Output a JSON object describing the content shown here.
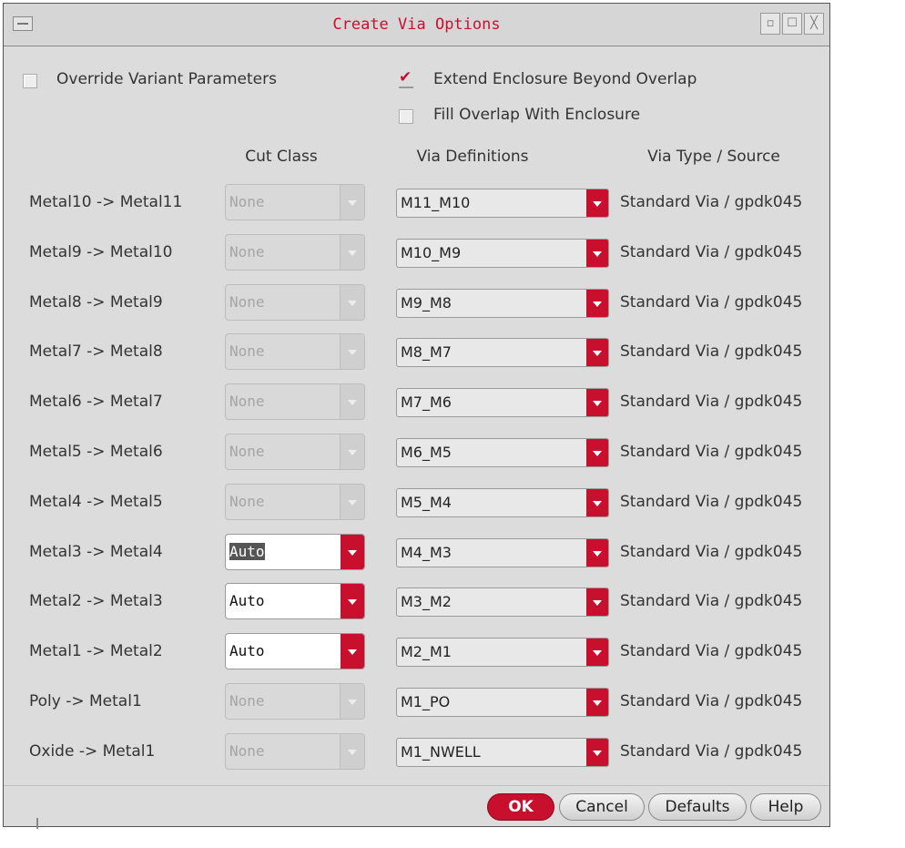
{
  "window": {
    "title": "Create Via Options"
  },
  "options": {
    "override_variant": {
      "label": "Override Variant Parameters",
      "checked": false
    },
    "extend_enclosure": {
      "label": "Extend Enclosure Beyond Overlap",
      "checked": true
    },
    "fill_overlap": {
      "label": "Fill Overlap With Enclosure",
      "checked": false
    }
  },
  "headers": {
    "cut_class": "Cut Class",
    "via_definitions": "Via Definitions",
    "via_type_source": "Via Type / Source"
  },
  "rows": [
    {
      "layers": "Metal10 -> Metal11",
      "cut_class": "None",
      "cut_enabled": false,
      "via": "M11_M10",
      "source": "Standard Via / gpdk045"
    },
    {
      "layers": "Metal9 -> Metal10",
      "cut_class": "None",
      "cut_enabled": false,
      "via": "M10_M9",
      "source": "Standard Via / gpdk045"
    },
    {
      "layers": "Metal8 -> Metal9",
      "cut_class": "None",
      "cut_enabled": false,
      "via": "M9_M8",
      "source": "Standard Via / gpdk045"
    },
    {
      "layers": "Metal7 -> Metal8",
      "cut_class": "None",
      "cut_enabled": false,
      "via": "M8_M7",
      "source": "Standard Via / gpdk045"
    },
    {
      "layers": "Metal6 -> Metal7",
      "cut_class": "None",
      "cut_enabled": false,
      "via": "M7_M6",
      "source": "Standard Via / gpdk045"
    },
    {
      "layers": "Metal5 -> Metal6",
      "cut_class": "None",
      "cut_enabled": false,
      "via": "M6_M5",
      "source": "Standard Via / gpdk045"
    },
    {
      "layers": "Metal4 -> Metal5",
      "cut_class": "None",
      "cut_enabled": false,
      "via": "M5_M4",
      "source": "Standard Via / gpdk045"
    },
    {
      "layers": "Metal3 -> Metal4",
      "cut_class": "Auto",
      "cut_enabled": true,
      "cut_selected": true,
      "via": "M4_M3",
      "source": "Standard Via / gpdk045"
    },
    {
      "layers": "Metal2 -> Metal3",
      "cut_class": "Auto",
      "cut_enabled": true,
      "via": "M3_M2",
      "source": "Standard Via / gpdk045"
    },
    {
      "layers": "Metal1 -> Metal2",
      "cut_class": "Auto",
      "cut_enabled": true,
      "via": "M2_M1",
      "source": "Standard Via / gpdk045"
    },
    {
      "layers": "Poly -> Metal1",
      "cut_class": "None",
      "cut_enabled": false,
      "via": "M1_PO",
      "source": "Standard Via / gpdk045"
    },
    {
      "layers": "Oxide -> Metal1",
      "cut_class": "None",
      "cut_enabled": false,
      "via": "M1_NWELL",
      "source": "Standard Via / gpdk045"
    }
  ],
  "buttons": {
    "ok": "OK",
    "cancel": "Cancel",
    "defaults": "Defaults",
    "help": "Help"
  },
  "colors": {
    "accent": "#c8102e",
    "panel": "#dcdcdc"
  }
}
